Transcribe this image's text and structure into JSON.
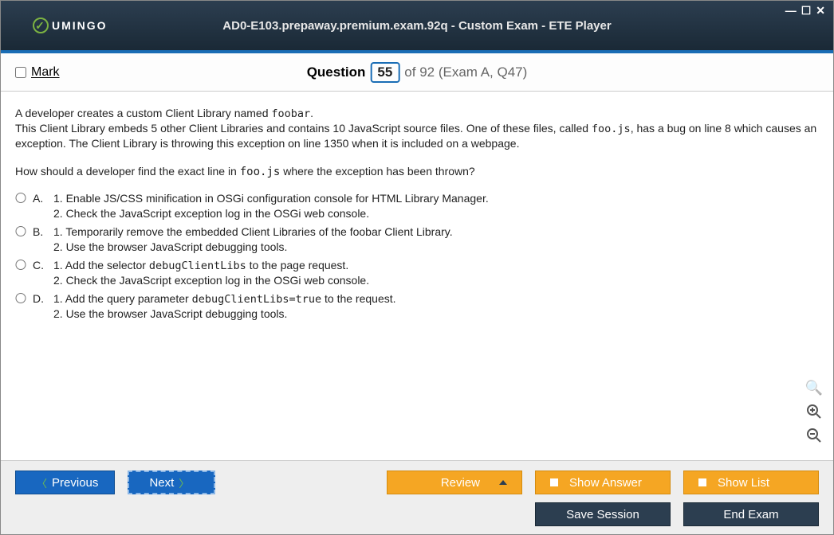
{
  "window": {
    "controls": {
      "minimize": "—",
      "maximize": "☐",
      "close": "✕"
    }
  },
  "brand": {
    "name": "UMINGO"
  },
  "app_title": "AD0-E103.prepaway.premium.exam.92q - Custom Exam - ETE Player",
  "mark": {
    "label": "Mark",
    "checked": false
  },
  "question_header": {
    "label": "Question",
    "number": "55",
    "rest": "of 92 (Exam A, Q47)"
  },
  "question": {
    "para1_a": "A developer creates a custom Client Library named ",
    "para1_code": "foobar",
    "para1_b": ".",
    "para2_a": "This Client Library embeds 5 other Client Libraries and contains 10 JavaScript source files. One of these files, called ",
    "para2_code": "foo.js",
    "para2_b": ", has a bug on line 8 which causes an exception. The Client Library is throwing this exception on line 1350 when it is included on a webpage.",
    "prompt_a": "How should a developer find the exact line in ",
    "prompt_code": "foo.js",
    "prompt_b": " where the exception has been thrown?"
  },
  "options": [
    {
      "letter": "A.",
      "line1": "1. Enable JS/CSS minification in OSGi configuration console for HTML Library Manager.",
      "line2": "2. Check the JavaScript exception log in the OSGi web console."
    },
    {
      "letter": "B.",
      "line1": "1. Temporarily remove the embedded Client Libraries of the foobar Client Library.",
      "line2": "2. Use the browser JavaScript debugging tools."
    },
    {
      "letter": "C.",
      "line1_a": "1. Add the selector ",
      "line1_code": "debugClientLibs",
      "line1_b": " to the page request.",
      "line2": "2. Check the JavaScript exception log in the OSGi web console."
    },
    {
      "letter": "D.",
      "line1_a": "1. Add the query parameter ",
      "line1_code": "debugClientLibs=true",
      "line1_b": " to the request.",
      "line2": "2. Use the browser JavaScript debugging tools."
    }
  ],
  "buttons": {
    "previous": "Previous",
    "next": "Next",
    "review": "Review",
    "show_answer": "Show Answer",
    "show_list": "Show List",
    "save_session": "Save Session",
    "end_exam": "End Exam"
  }
}
